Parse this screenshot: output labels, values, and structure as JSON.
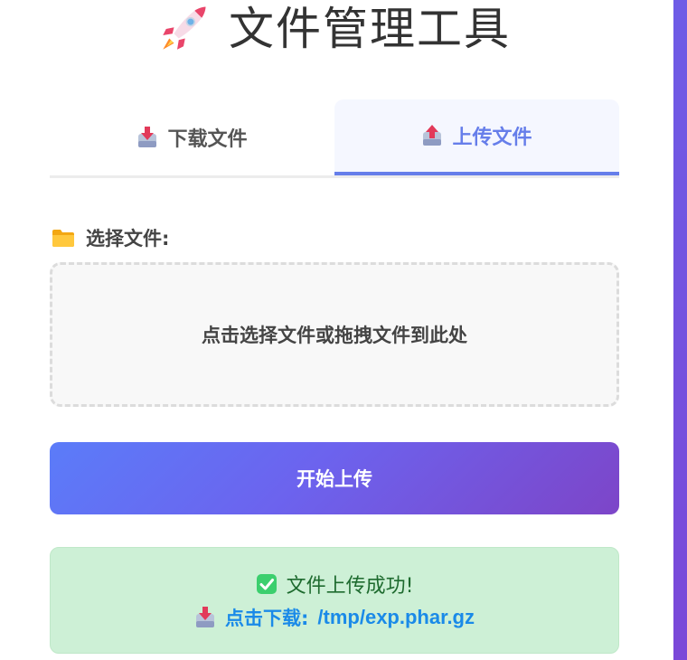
{
  "header": {
    "title": "文件管理工具",
    "icon": "rocket-icon"
  },
  "tabs": [
    {
      "label": "下载文件",
      "icon": "inbox-download-icon",
      "active": false
    },
    {
      "label": "上传文件",
      "icon": "outbox-upload-icon",
      "active": true
    }
  ],
  "upload_form": {
    "label": "选择文件:",
    "label_icon": "folder-icon",
    "dropzone_text": "点击选择文件或拖拽文件到此处",
    "submit_label": "开始上传"
  },
  "result": {
    "status_icon": "check-mark-icon",
    "message": "文件上传成功!",
    "link_icon": "inbox-download-icon",
    "link_prefix": "点击下载:",
    "link_path": "/tmp/exp.phar.gz"
  },
  "colors": {
    "accent": "#667eea",
    "accent_end": "#7d45c8",
    "success_bg": "#cdf0d6",
    "success_text": "#1e6b2f",
    "link": "#1a8ae8"
  }
}
